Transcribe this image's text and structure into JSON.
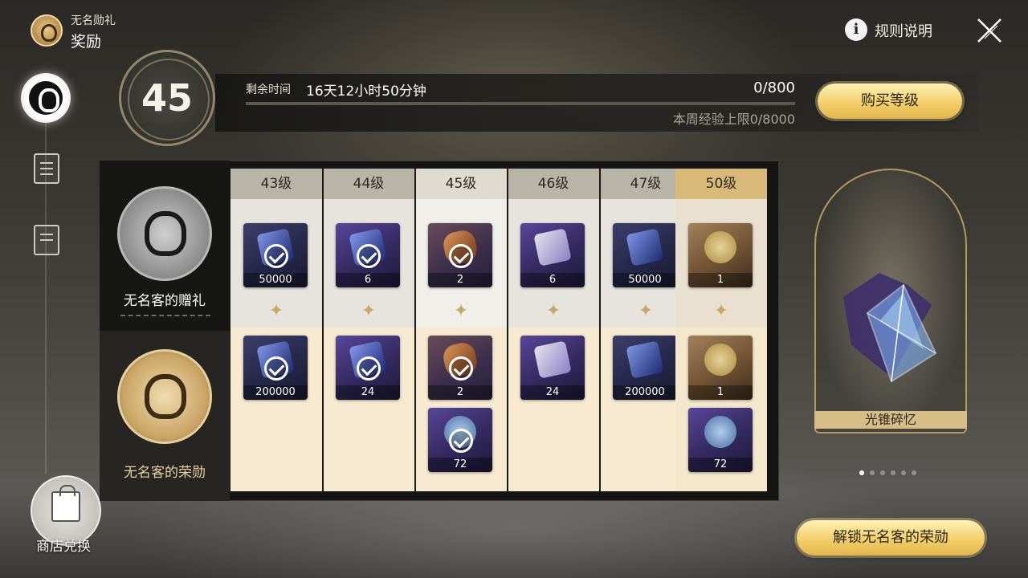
{
  "header": {
    "subtitle": "无名勋礼",
    "title": "奖励",
    "rules_label": "规则说明"
  },
  "level": {
    "current": "45",
    "remain_label": "剩余时间",
    "remain_value": "16天12小时50分钟",
    "exp": "0/800",
    "exp_progress": 0,
    "weekly_cap": "本周经验上限0/8000",
    "buy_button": "购买等级"
  },
  "tracks": {
    "free_name": "无名客的赠礼",
    "paid_name": "无名客的荣勋"
  },
  "columns": [
    {
      "label": "43级",
      "free": [
        {
          "count": "50000",
          "claimed": true,
          "icon": "pass-ticket-icon"
        }
      ],
      "paid": [
        {
          "count": "200000",
          "claimed": true,
          "icon": "pass-ticket-icon"
        }
      ]
    },
    {
      "label": "44级",
      "free": [
        {
          "count": "6",
          "claimed": true,
          "icon": "purple-book-icon"
        }
      ],
      "paid": [
        {
          "count": "24",
          "claimed": true,
          "icon": "purple-book-icon"
        }
      ]
    },
    {
      "label": "45级",
      "free": [
        {
          "count": "2",
          "claimed": true,
          "icon": "material-flask-icon"
        }
      ],
      "paid": [
        {
          "count": "2",
          "claimed": true,
          "icon": "material-flask-icon"
        },
        {
          "count": "72",
          "claimed": true,
          "icon": "ember-bottle-icon"
        }
      ]
    },
    {
      "label": "46级",
      "free": [
        {
          "count": "6",
          "claimed": false,
          "icon": "crystal-lantern-icon"
        }
      ],
      "paid": [
        {
          "count": "24",
          "claimed": false,
          "icon": "crystal-lantern-icon"
        }
      ]
    },
    {
      "label": "47级",
      "free": [
        {
          "count": "50000",
          "claimed": false,
          "icon": "pass-ticket-icon"
        }
      ],
      "paid": [
        {
          "count": "200000",
          "claimed": false,
          "icon": "pass-ticket-icon"
        }
      ]
    },
    {
      "label": "50级",
      "free": [
        {
          "count": "1",
          "claimed": false,
          "icon": "gold-trophy-icon"
        }
      ],
      "paid": [
        {
          "count": "1",
          "claimed": false,
          "icon": "gold-trophy-icon"
        },
        {
          "count": "72",
          "claimed": false,
          "icon": "ember-bottle-icon"
        }
      ]
    }
  ],
  "preview": {
    "label": "光锥碎忆",
    "page_count": 6,
    "active_page": 1
  },
  "unlock_button": "解锁无名客的荣勋",
  "shop_label": "商店兑换"
}
